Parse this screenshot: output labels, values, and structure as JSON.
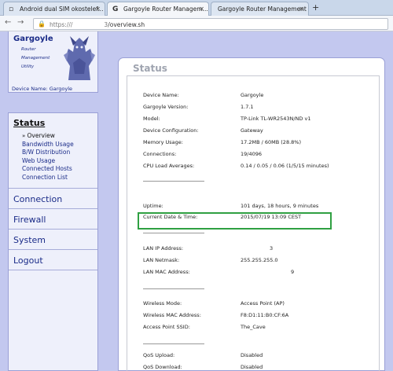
{
  "browser": {
    "tabs": [
      {
        "label": "Android dual SIM okostelef...",
        "icon": "generic-page-icon"
      },
      {
        "label": "Gargoyle Router Managem...",
        "icon": "gargoyle-g-icon"
      },
      {
        "label": "Gargoyle Router Management ...",
        "icon": "generic-page-icon"
      }
    ],
    "new_tab": "+",
    "url_prefix": "https://",
    "url_mid": "/",
    "url_host": "3",
    "url_path": "/overview.sh"
  },
  "logo": {
    "title": "Gargoyle",
    "subtitle_lines": [
      "Router",
      "Management",
      "Utility"
    ],
    "device_name": "Device Name: Gargoyle"
  },
  "menu": {
    "status_label": "Status",
    "status_items": [
      "Overview",
      "Bandwidth Usage",
      "B/W Distribution",
      "Web Usage",
      "Connected Hosts",
      "Connection List"
    ],
    "current_item": "Overview",
    "sections": [
      "Connection",
      "Firewall",
      "System",
      "Logout"
    ]
  },
  "status": {
    "header": "Status",
    "rows": [
      {
        "label": "Device Name:",
        "value": "Gargoyle"
      },
      {
        "label": "Gargoyle Version:",
        "value": "1.7.1"
      },
      {
        "label": "Model:",
        "value": "TP-Link TL-WR2543N/ND v1"
      },
      {
        "label": "Device Configuration:",
        "value": "Gateway"
      },
      {
        "label": "Memory Usage:",
        "value": "17.2MB / 60MB (28.8%)"
      },
      {
        "label": "Connections:",
        "value": "19/4096"
      },
      {
        "label": "CPU Load Averages:",
        "value": "0.14 / 0.05 / 0.06  (1/5/15 minutes)"
      },
      {
        "label": "Uptime:",
        "value": "101 days, 18 hours, 9 minutes"
      },
      {
        "label": "Current Date & Time:",
        "value": "2015/07/19 13:09 CEST"
      },
      {
        "label": "LAN IP Address:",
        "value": "3"
      },
      {
        "label": "LAN Netmask:",
        "value": "255.255.255.0"
      },
      {
        "label": "LAN MAC Address:",
        "value": "9"
      },
      {
        "label": "Wireless Mode:",
        "value": "Access Point (AP)"
      },
      {
        "label": "Wireless MAC Address:",
        "value": "F8:D1:11:B0:CF:6A"
      },
      {
        "label": "Access Point SSID:",
        "value": "The_Cave"
      },
      {
        "label": "QoS Upload:",
        "value": "Disabled"
      },
      {
        "label": "QoS Download:",
        "value": "Disabled"
      }
    ]
  },
  "colors": {
    "page_background": "#c3c8ef",
    "link_blue": "#1a2b88",
    "highlight_green": "#2fa042"
  }
}
